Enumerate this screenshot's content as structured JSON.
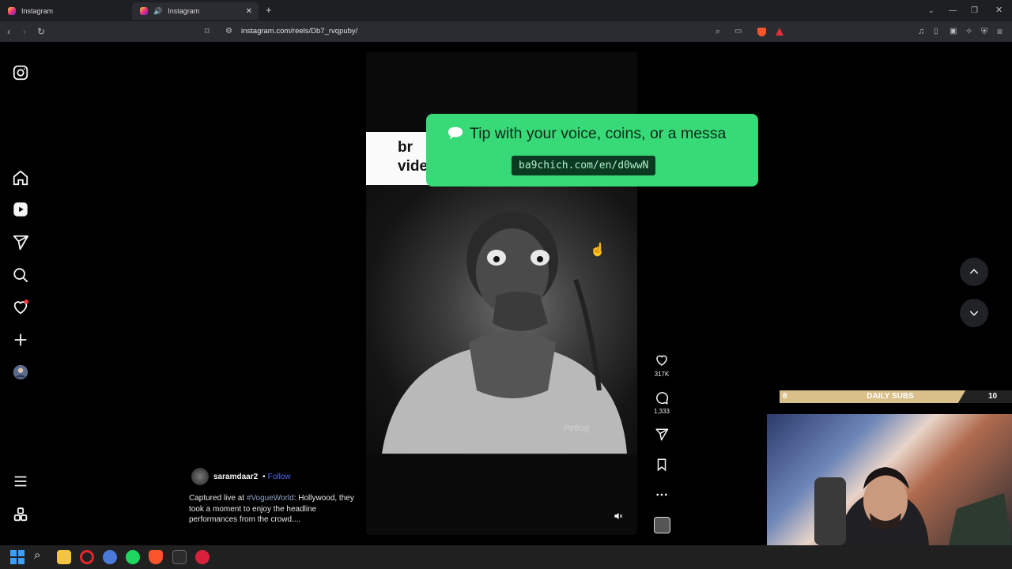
{
  "browser": {
    "tabs": [
      {
        "label": "Instagram",
        "active": false
      },
      {
        "label": "Instagram",
        "active": true
      }
    ],
    "new_tab": "+",
    "url": "instagram.com/reels/Db7_rvqpuby/"
  },
  "reel": {
    "overlay_card_text": "br\nvide",
    "tip": {
      "message": "Tip with your voice, coins, or a messa",
      "link": "ba9chich.com/en/d0wwN"
    },
    "watermark": "Pefrog",
    "author": {
      "username": "saramdaar2",
      "separator": "•",
      "follow_label": "Follow"
    },
    "caption": {
      "prefix": "Captured live at ",
      "hashtag": "#VogueWorld",
      "rest": ": Hollywood, they took a moment to enjoy the headline performances from the crowd...."
    },
    "actions": {
      "likes": "317K",
      "comments": "1,333"
    }
  },
  "stream_overlay": {
    "subs_current": "8",
    "subs_title": "DAILY SUBS",
    "subs_goal": "10",
    "subs_progress": 0.8
  },
  "icons": {
    "nav": [
      "instagram-logo-icon",
      "home-icon",
      "reels-icon",
      "send-icon",
      "search-icon",
      "heart-icon",
      "create-icon",
      "profile-avatar",
      "menu-icon",
      "more-apps-icon"
    ],
    "actions": [
      "heart-icon",
      "comment-icon",
      "share-icon",
      "bookmark-icon",
      "more-icon",
      "audio-avatar"
    ]
  },
  "colors": {
    "tip_bg": "#38d977",
    "tip_link_bg": "#0b3a23",
    "follow": "#4f6bed",
    "notification_dot": "#ff3040"
  }
}
